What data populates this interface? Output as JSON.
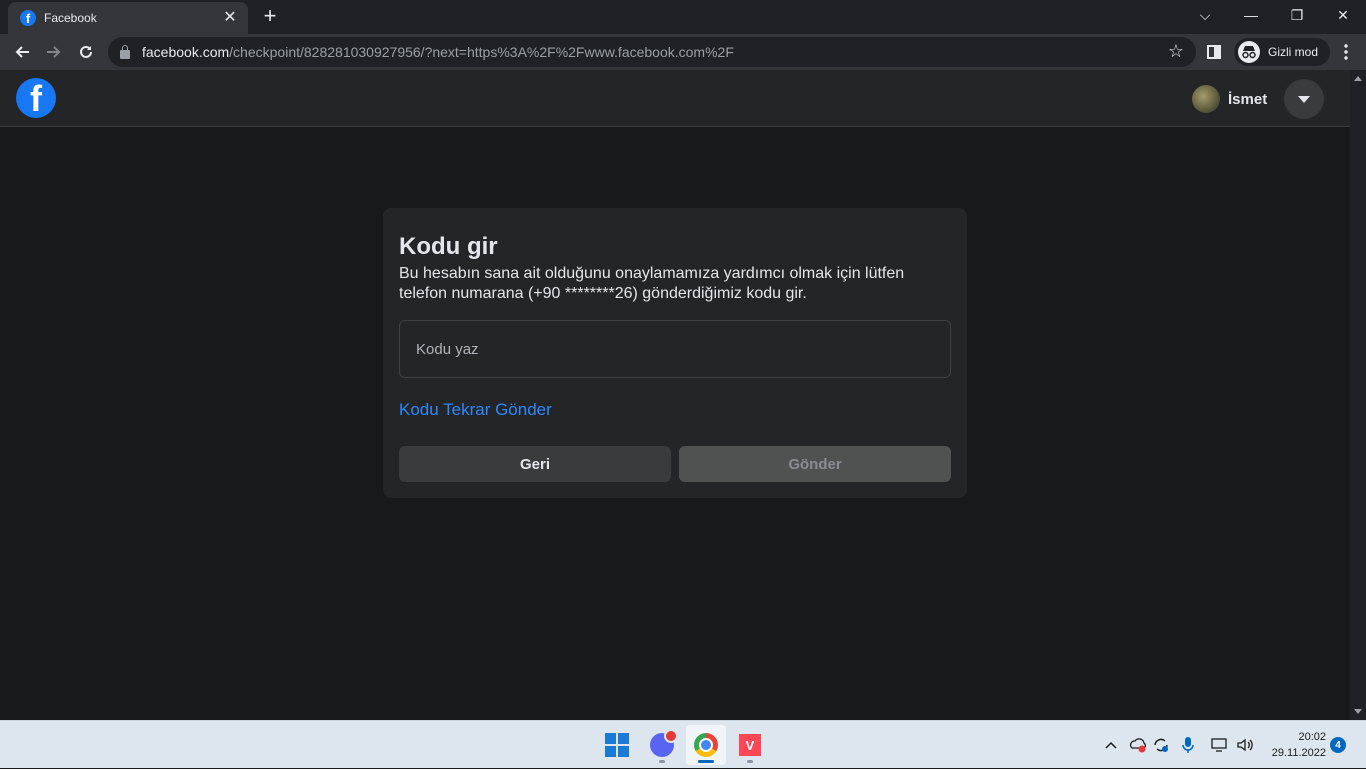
{
  "browser": {
    "tab_title": "Facebook",
    "tab_favicon_letter": "f",
    "close_tab_glyph": "✕",
    "new_tab_glyph": "+",
    "url_host": "facebook.com",
    "url_path": "/checkpoint/828281030927956/?next=https%3A%2F%2Fwww.facebook.com%2F",
    "incognito_label": "Gizli mod",
    "icons": [
      "back-icon",
      "forward-icon",
      "reload-icon",
      "lock-icon",
      "star-icon",
      "sidebar-icon",
      "incognito-icon",
      "kebab-menu-icon"
    ]
  },
  "window_controls": {
    "dropdown": "⌵",
    "minimize": "—",
    "restore": "❐",
    "close": "✕"
  },
  "header": {
    "logo_letter": "f",
    "profile_name": "İsmet"
  },
  "card": {
    "title": "Kodu gir",
    "description": "Bu hesabın sana ait olduğunu onaylamamıza yardımcı olmak için lütfen telefon numarana (+90 ********26) gönderdiğimiz kodu gir.",
    "code_placeholder": "Kodu yaz",
    "code_value": "",
    "resend_link": "Kodu Tekrar Gönder",
    "back_button": "Geri",
    "send_button": "Gönder"
  },
  "taskbar": {
    "apps": [
      "windows-start",
      "discord",
      "chrome",
      "valorant"
    ],
    "time": "20:02",
    "date": "29.11.2022",
    "notification_count": "4"
  },
  "colors": {
    "page_bg": "#18191a",
    "card_bg": "#242526",
    "link": "#2d88ff",
    "brand": "#1877f2"
  }
}
